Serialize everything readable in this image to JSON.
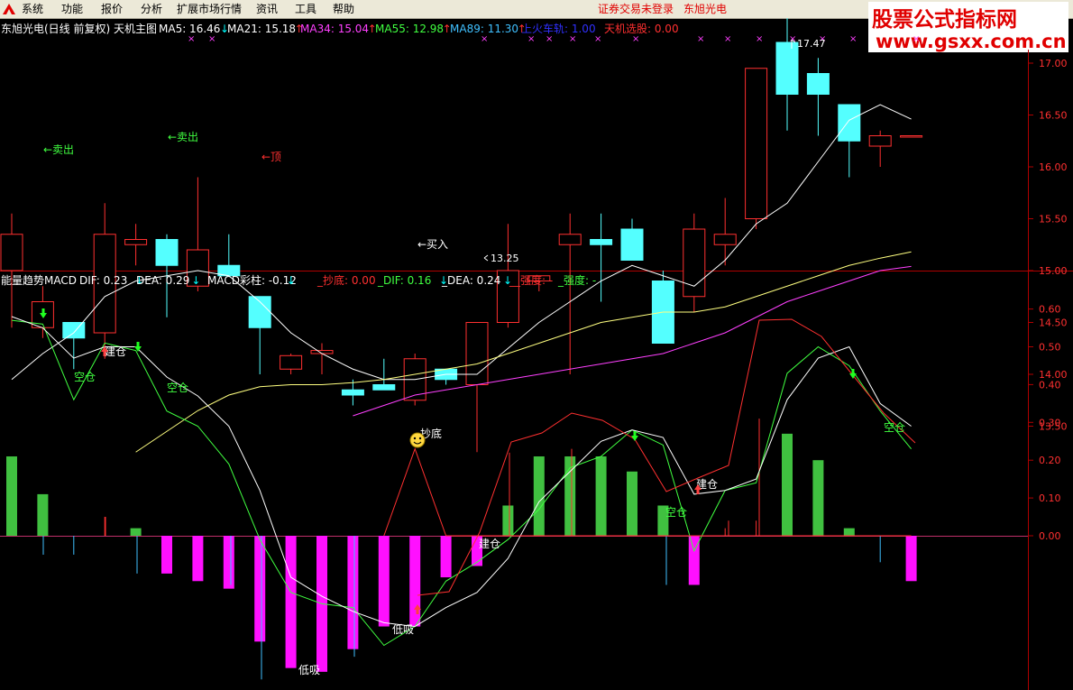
{
  "menubar": {
    "items": [
      "系统",
      "功能",
      "报价",
      "分析",
      "扩展市场行情",
      "资讯",
      "工具",
      "帮助"
    ],
    "status_text": "证券交易未登录",
    "stock_name": "东旭光电"
  },
  "watermark": {
    "title": "股票公式指标网",
    "url": "www.gsxx.com.cn"
  },
  "main_panel": {
    "title": "东旭光电(日线 前复权) 天机主图",
    "indicators": [
      {
        "label": "MA5: 16.46",
        "arrow": "↓",
        "color": "#ffffff",
        "arrow_color": "#00ffff"
      },
      {
        "label": "MA21: 15.18",
        "arrow": "↑",
        "color": "#ffffff",
        "arrow_color": "#ff3030"
      },
      {
        "label": "MA34: 15.04",
        "arrow": "↑",
        "color": "#ff40ff",
        "arrow_color": "#ff3030"
      },
      {
        "label": "MA55: 12.98",
        "arrow": "↑",
        "color": "#40ff40",
        "arrow_color": "#ff3030"
      },
      {
        "label": "MA89: 11.30",
        "arrow": "↑",
        "color": "#40c0ff",
        "arrow_color": "#ff3030"
      },
      {
        "label": "上火车轨: 1.00",
        "arrow": "",
        "color": "#3030ff",
        "arrow_color": "#3030ff"
      },
      {
        "label": "天机选股: 0.00",
        "arrow": "",
        "color": "#ff3030",
        "arrow_color": "#ff3030"
      }
    ],
    "y_axis": [
      "17.00",
      "16.50",
      "16.00",
      "15.50",
      "15.00",
      "14.50",
      "14.00",
      "13.50"
    ],
    "annotations": {
      "sell1": "←卖出",
      "sell2": "←卖出",
      "top": "←顶",
      "buy": "←买入",
      "high": "17.47",
      "low": "13.25"
    }
  },
  "macd_panel": {
    "title": "能量趋势MACD",
    "indicators": [
      {
        "label": "DIF: 0.23",
        "arrow": "↓",
        "color": "#ffffff",
        "arrow_color": "#00ffff"
      },
      {
        "label": "DEA: 0.29",
        "arrow": "↓",
        "color": "#ffffff",
        "arrow_color": "#00ffff"
      },
      {
        "label": "MACD彩柱: -0.12",
        "arrow": "↓",
        "color": "#ffffff",
        "arrow_color": "#00ffff"
      },
      {
        "label": "_抄底: 0.00",
        "arrow": "",
        "color": "#ff3030",
        "arrow_color": "#ff3030"
      },
      {
        "label": "_DIF: 0.16",
        "arrow": "↓",
        "color": "#40ff40",
        "arrow_color": "#00ffff"
      },
      {
        "label": "_DEA: 0.24",
        "arrow": "↓",
        "color": "#ffffff",
        "arrow_color": "#00ffff"
      },
      {
        "label": "__强度: -",
        "arrow": "",
        "color": "#ff3030",
        "arrow_color": "#ff3030"
      },
      {
        "label": "_强度: -",
        "arrow": "",
        "color": "#40ff40",
        "arrow_color": "#40ff40"
      }
    ],
    "y_axis": [
      "0.60",
      "0.50",
      "0.40",
      "0.30",
      "0.20",
      "0.10",
      "0.00"
    ],
    "labels": {
      "empty1": "空仓",
      "empty2": "空仓",
      "empty3": "空仓",
      "empty4": "空仓",
      "build1": "建仓",
      "build2": "建仓",
      "build3": "建仓",
      "low1": "低吸",
      "low2": "低吸",
      "bottom": "抄底"
    }
  },
  "colors": {
    "up": "#ff3030",
    "down": "#54ffff",
    "ma5": "#ffffff",
    "ma21": "#ffff80",
    "ma34": "#ff40ff",
    "grid": "#8b0000",
    "hist_pos": "#40c040",
    "hist_neg": "#ff10ff"
  },
  "chart_data": [
    {
      "type": "candlestick",
      "title": "东旭光电(日线 前复权) 天机主图",
      "ylim": [
        13.25,
        17.47
      ],
      "candles": [
        {
          "o": 15.0,
          "h": 15.55,
          "l": 14.45,
          "c": 15.35
        },
        {
          "o": 14.45,
          "h": 14.85,
          "l": 14.35,
          "c": 14.7
        },
        {
          "o": 14.5,
          "h": 14.5,
          "l": 14.05,
          "c": 14.35
        },
        {
          "o": 14.4,
          "h": 15.65,
          "l": 14.15,
          "c": 15.35
        },
        {
          "o": 15.25,
          "h": 15.45,
          "l": 15.05,
          "c": 15.3
        },
        {
          "o": 15.3,
          "h": 15.35,
          "l": 14.55,
          "c": 15.05
        },
        {
          "o": 14.85,
          "h": 15.9,
          "l": 14.8,
          "c": 15.2
        },
        {
          "o": 15.05,
          "h": 15.35,
          "l": 14.95,
          "c": 14.95
        },
        {
          "o": 14.75,
          "h": 14.75,
          "l": 14.0,
          "c": 14.45
        },
        {
          "o": 14.05,
          "h": 14.2,
          "l": 14.0,
          "c": 14.18
        },
        {
          "o": 14.2,
          "h": 14.3,
          "l": 14.0,
          "c": 14.23
        },
        {
          "o": 13.85,
          "h": 13.95,
          "l": 13.7,
          "c": 13.8
        },
        {
          "o": 13.9,
          "h": 14.15,
          "l": 13.85,
          "c": 13.85
        },
        {
          "o": 13.75,
          "h": 14.2,
          "l": 13.7,
          "c": 14.15
        },
        {
          "o": 14.05,
          "h": 14.05,
          "l": 13.9,
          "c": 13.95
        },
        {
          "o": 13.9,
          "h": 14.45,
          "l": 13.25,
          "c": 14.5
        },
        {
          "o": 14.5,
          "h": 15.45,
          "l": 14.45,
          "c": 15.0
        },
        {
          "o": 14.9,
          "h": 14.9,
          "l": 14.8,
          "c": 14.95
        },
        {
          "o": 15.25,
          "h": 15.55,
          "l": 14.0,
          "c": 15.35
        },
        {
          "o": 15.3,
          "h": 15.55,
          "l": 14.7,
          "c": 15.25
        },
        {
          "o": 15.4,
          "h": 15.5,
          "l": 15.1,
          "c": 15.1
        },
        {
          "o": 14.9,
          "h": 15.0,
          "l": 14.3,
          "c": 14.3
        },
        {
          "o": 14.75,
          "h": 15.55,
          "l": 14.6,
          "c": 15.4
        },
        {
          "o": 15.25,
          "h": 15.7,
          "l": 15.05,
          "c": 15.35
        },
        {
          "o": 15.5,
          "h": 16.95,
          "l": 15.4,
          "c": 16.95
        },
        {
          "o": 17.2,
          "h": 17.47,
          "l": 16.35,
          "c": 16.7
        },
        {
          "o": 16.9,
          "h": 17.05,
          "l": 16.3,
          "c": 16.7
        },
        {
          "o": 16.6,
          "h": 16.6,
          "l": 15.9,
          "c": 16.25
        },
        {
          "o": 16.2,
          "h": 16.35,
          "l": 16.0,
          "c": 16.3
        },
        {
          "o": 16.3,
          "h": 16.3,
          "l": 16.3,
          "c": 16.3
        }
      ],
      "series": [
        {
          "name": "MA5",
          "values": [
            13.95,
            14.2,
            14.4,
            14.75,
            14.9,
            14.95,
            15.0,
            14.95,
            14.7,
            14.4,
            14.2,
            14.05,
            13.95,
            13.95,
            14.0,
            14.0,
            14.25,
            14.5,
            14.7,
            14.9,
            15.05,
            14.95,
            14.85,
            15.1,
            15.45,
            15.65,
            16.05,
            16.45,
            16.6,
            16.46
          ]
        },
        {
          "name": "MA21",
          "values": [
            null,
            null,
            null,
            null,
            13.25,
            13.45,
            13.65,
            13.8,
            13.88,
            13.9,
            13.9,
            13.92,
            13.95,
            14.0,
            14.05,
            14.1,
            14.2,
            14.3,
            14.4,
            14.5,
            14.55,
            14.6,
            14.6,
            14.65,
            14.75,
            14.85,
            14.95,
            15.05,
            15.12,
            15.18
          ]
        },
        {
          "name": "MA34",
          "values": [
            null,
            null,
            null,
            null,
            null,
            null,
            null,
            null,
            null,
            null,
            null,
            13.6,
            13.7,
            13.8,
            13.85,
            13.9,
            13.95,
            14.0,
            14.05,
            14.1,
            14.15,
            14.2,
            14.3,
            14.4,
            14.55,
            14.7,
            14.8,
            14.9,
            15.0,
            15.04
          ]
        }
      ]
    },
    {
      "type": "line",
      "title": "能量趋势MACD",
      "ylim": [
        -0.37,
        0.63
      ],
      "series": [
        {
          "name": "DIF",
          "values": [
            0.57,
            0.56,
            0.36,
            0.51,
            0.49,
            0.33,
            0.29,
            0.19,
            -0.01,
            -0.15,
            -0.18,
            -0.19,
            -0.29,
            -0.24,
            -0.12,
            -0.07,
            -0.01,
            0.07,
            0.18,
            0.21,
            0.28,
            0.24,
            -0.04,
            0.12,
            0.14,
            0.43,
            0.5,
            0.45,
            0.33,
            0.23
          ]
        },
        {
          "name": "DEA",
          "values": [
            0.58,
            0.55,
            0.47,
            0.5,
            0.5,
            0.42,
            0.37,
            0.29,
            0.12,
            -0.11,
            -0.16,
            -0.2,
            -0.23,
            -0.24,
            -0.19,
            -0.15,
            -0.06,
            0.09,
            0.17,
            0.25,
            0.28,
            0.26,
            0.11,
            0.12,
            0.15,
            0.36,
            0.47,
            0.5,
            0.35,
            0.29
          ]
        },
        {
          "name": "MACD",
          "values": [
            0.21,
            0.11,
            -0.05,
            0.05,
            0.02,
            -0.1,
            -0.12,
            -0.14,
            -0.28,
            -0.35,
            -0.36,
            -0.3,
            -0.24,
            -0.24,
            -0.11,
            -0.08,
            0.08,
            0.21,
            0.21,
            0.21,
            0.17,
            0.08,
            -0.13,
            0.02,
            0.04,
            0.27,
            0.2,
            0.02,
            -0.07,
            -0.12
          ]
        },
        {
          "name": "抄底",
          "values": [
            null,
            null,
            null,
            null,
            null,
            null,
            null,
            null,
            null,
            null,
            null,
            null,
            0.0,
            0.23,
            0.0,
            null,
            null,
            null,
            null,
            null,
            null,
            null,
            null,
            null,
            null,
            null,
            null,
            null,
            null,
            0.0
          ]
        }
      ]
    }
  ]
}
